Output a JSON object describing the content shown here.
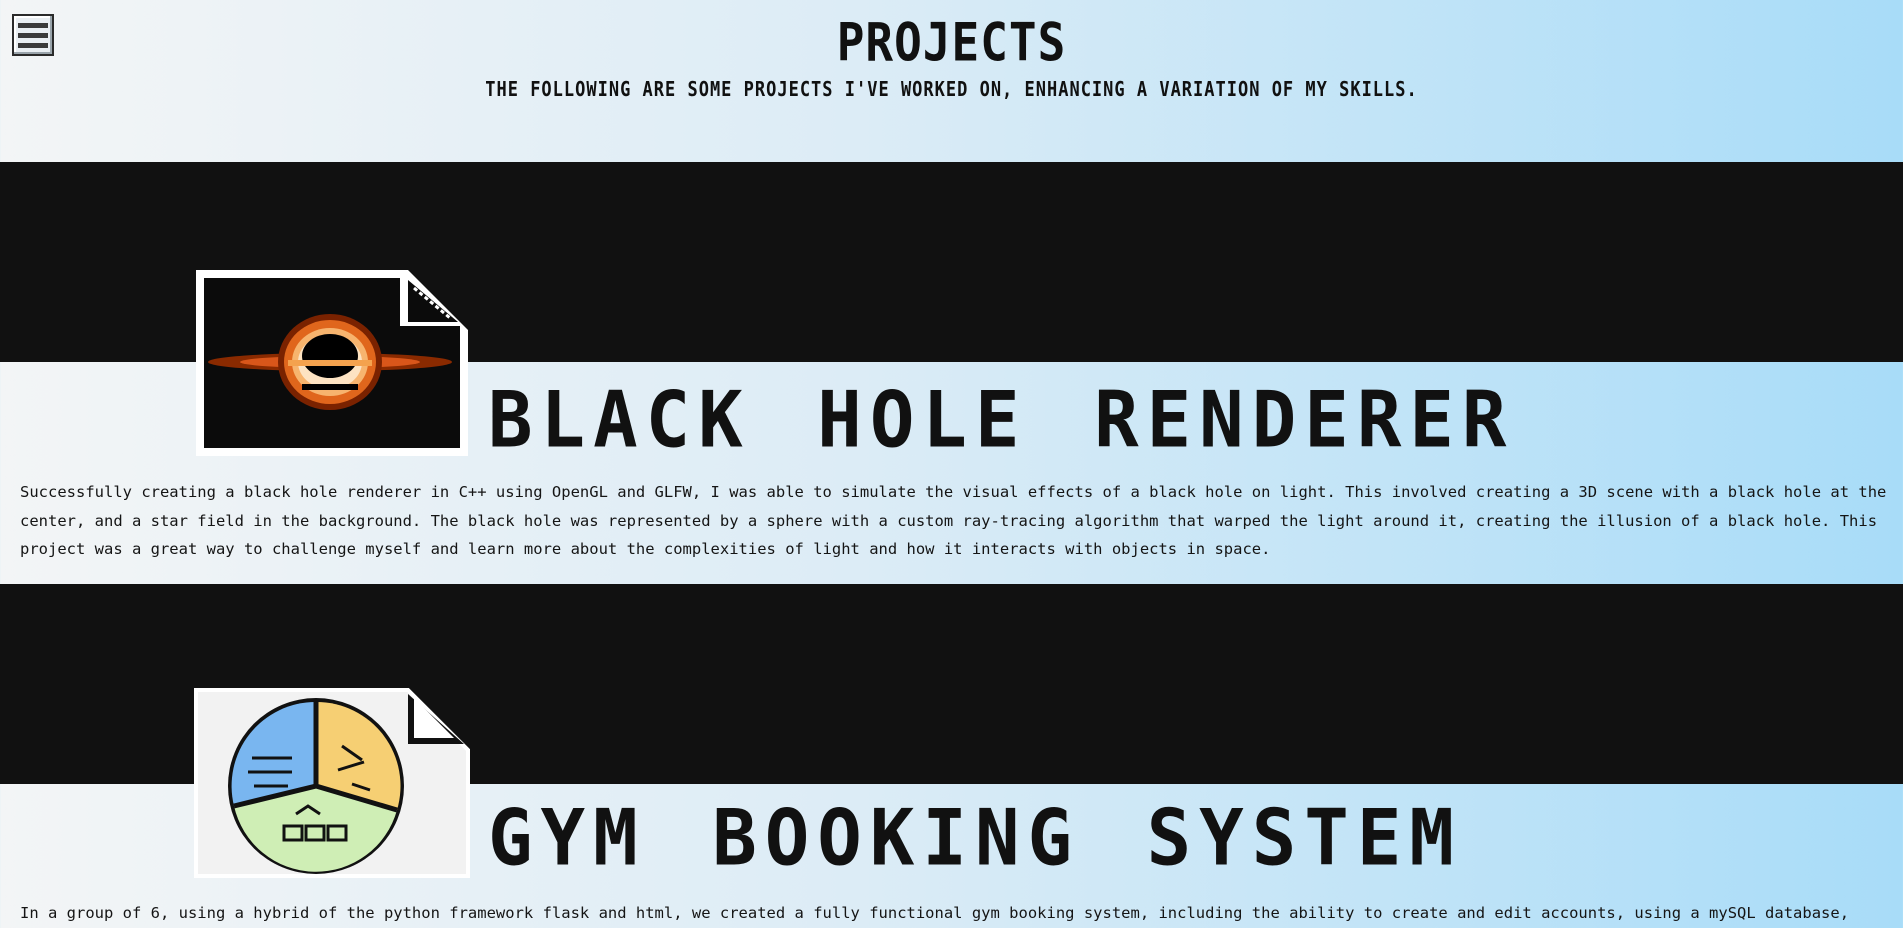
{
  "nav": {
    "menu_icon": "hamburger-icon"
  },
  "header": {
    "title": "PROJECTS",
    "subtitle": "THE FOLLOWING ARE SOME PROJECTS I'VE WORKED ON, ENHANCING A VARIATION OF MY SKILLS."
  },
  "projects": [
    {
      "title": "BLACK HOLE RENDERER",
      "image": "black-hole-thumbnail",
      "description": "Successfully creating a black hole renderer in C++ using OpenGL and GLFW, I was able to simulate the visual effects of a black hole on light. This involved creating a 3D scene with a black hole at the center, and a star field in the background. The black hole was represented by a sphere with a custom ray-tracing algorithm that warped the light around it, creating the illusion of a black hole. This project was a great way to challenge myself and learn more about the complexities of light and how it interacts with objects in space."
    },
    {
      "title": "GYM BOOKING SYSTEM",
      "image": "pie-chart-thumbnail",
      "description": "In a group of 6, using a hybrid of the python framework flask and html, we created a fully functional gym booking system, including the ability to create and edit accounts, using a mySQL database,"
    }
  ],
  "colors": {
    "band": "#111111",
    "gradient_start": "#f3f5f6",
    "gradient_end": "#a8dcf8"
  }
}
